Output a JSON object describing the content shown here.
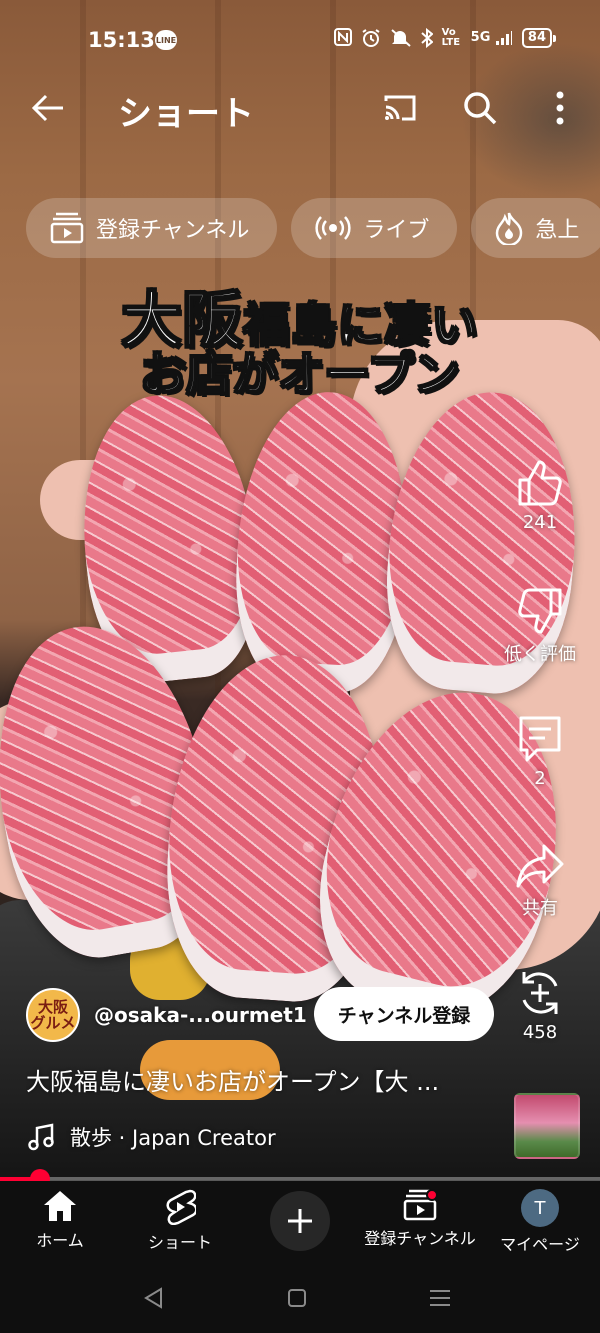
{
  "status_bar": {
    "time": "15:13",
    "line_app_badge": "LINE",
    "network_label": "5G",
    "volte_label": "Vo LTE",
    "battery_percent": "84"
  },
  "app_bar": {
    "title": "ショート"
  },
  "chips": [
    {
      "label": "登録チャンネル",
      "icon": "subscriptions-icon"
    },
    {
      "label": "ライブ",
      "icon": "live-icon"
    },
    {
      "label": "急上",
      "icon": "trending-icon"
    }
  ],
  "video_overlay": {
    "line1_big": "大阪",
    "line1_rest": "福島に凄い",
    "line2": "お店がオープン"
  },
  "actions": {
    "like_count": "241",
    "dislike_label": "低く評価",
    "comment_count": "2",
    "share_label": "共有",
    "remix_count": "458"
  },
  "channel": {
    "avatar_text_line1": "大阪",
    "avatar_text_line2": "グルメ",
    "handle": "@osaka-...ourmet1",
    "subscribe_label": "チャンネル登録"
  },
  "video": {
    "title": "大阪福島に凄いお店がオープン【大 ...",
    "music": "散歩 · Japan Creator",
    "progress_percent": 6.7
  },
  "bottom_nav": {
    "home_label": "ホーム",
    "shorts_label": "ショート",
    "subscriptions_label": "登録チャンネル",
    "you_label": "マイページ",
    "profile_initial": "T"
  },
  "colors": {
    "accent_red": "#ff0033",
    "nav_background": "#0f0f0f"
  }
}
